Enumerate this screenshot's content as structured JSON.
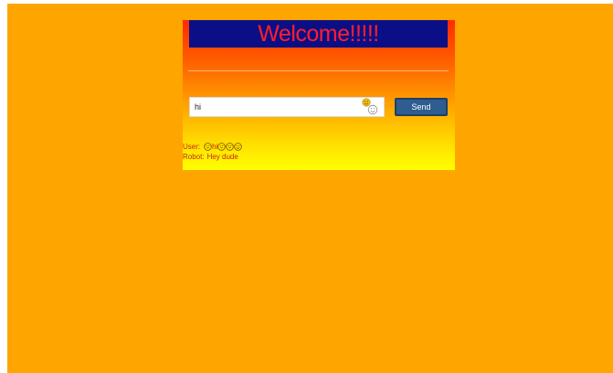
{
  "banner": {
    "title": "Welcome!!!!!"
  },
  "composer": {
    "input_value": "hi",
    "send_label": "Send"
  },
  "chat": {
    "messages": [
      {
        "speaker": "User",
        "text": "hi",
        "emoji_before": [
          "grinning-face"
        ],
        "emoji_after": [
          "grinning-face",
          "grinning-face",
          "smiling-face"
        ]
      },
      {
        "speaker": "Robot",
        "text": "Hey dude"
      }
    ]
  },
  "colors": {
    "page_background": "#ffa500",
    "banner_background": "#0b0f86",
    "banner_text": "#ff1e2c",
    "panel_gradient_top": "#ff2a00",
    "panel_gradient_bottom": "#ffff00",
    "send_button": "#2e5d8f",
    "chat_text": "#c8201a"
  },
  "icons": {
    "emoji_picker": "emoji-picker-icon"
  }
}
